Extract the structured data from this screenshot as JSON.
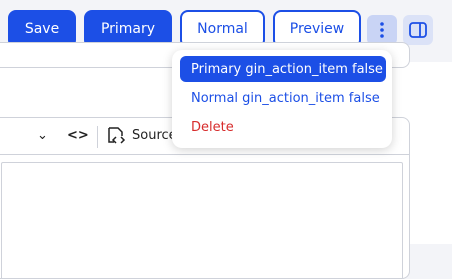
{
  "toolbar": {
    "save_label": "Save",
    "primary_label": "Primary",
    "normal_label": "Normal",
    "preview_label": "Preview",
    "more_icon": "kebab-vertical-icon",
    "sidebar_icon": "sidebar-toggle-icon"
  },
  "editor": {
    "chevron_icon": "⌄",
    "code_icon": "<>",
    "source_label": "Source"
  },
  "dropdown": {
    "items": [
      {
        "label": "Primary gin_action_item false",
        "style": "primary"
      },
      {
        "label": "Normal gin_action_item false",
        "style": "normal"
      },
      {
        "label": "Delete",
        "style": "danger"
      }
    ]
  },
  "colors": {
    "accent": "#1c4fe6",
    "danger": "#d72c2c",
    "background": "#f3f4f8"
  }
}
